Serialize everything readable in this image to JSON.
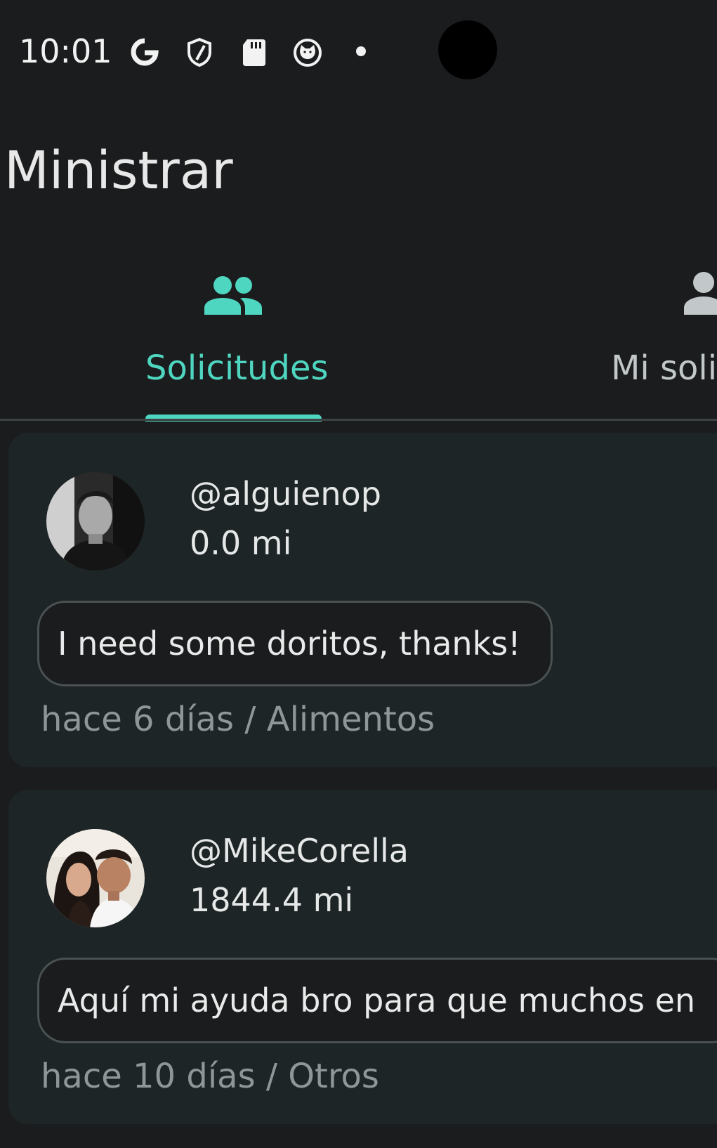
{
  "status_bar": {
    "time": "10:01",
    "icons": [
      "google-icon",
      "shield-icon",
      "sd-card-icon",
      "cat-icon",
      "dot-icon"
    ]
  },
  "app": {
    "title": "Ministrar"
  },
  "tabs": [
    {
      "label": "Solicitudes",
      "icon": "people-icon",
      "active": true
    },
    {
      "label": "Mi soli",
      "icon": "person-icon",
      "active": false
    }
  ],
  "colors": {
    "accent": "#4fd6c1",
    "background": "#1b1c1d",
    "card": "#1e2526"
  },
  "requests": [
    {
      "username": "@alguienop",
      "distance": "0.0 mi",
      "message": "I need some doritos, thanks!",
      "meta": "hace 6 días / Alimentos"
    },
    {
      "username": "@MikeCorella",
      "distance": "1844.4 mi",
      "message": "Aquí mi ayuda bro para que muchos en",
      "meta": "hace 10 días / Otros"
    }
  ]
}
